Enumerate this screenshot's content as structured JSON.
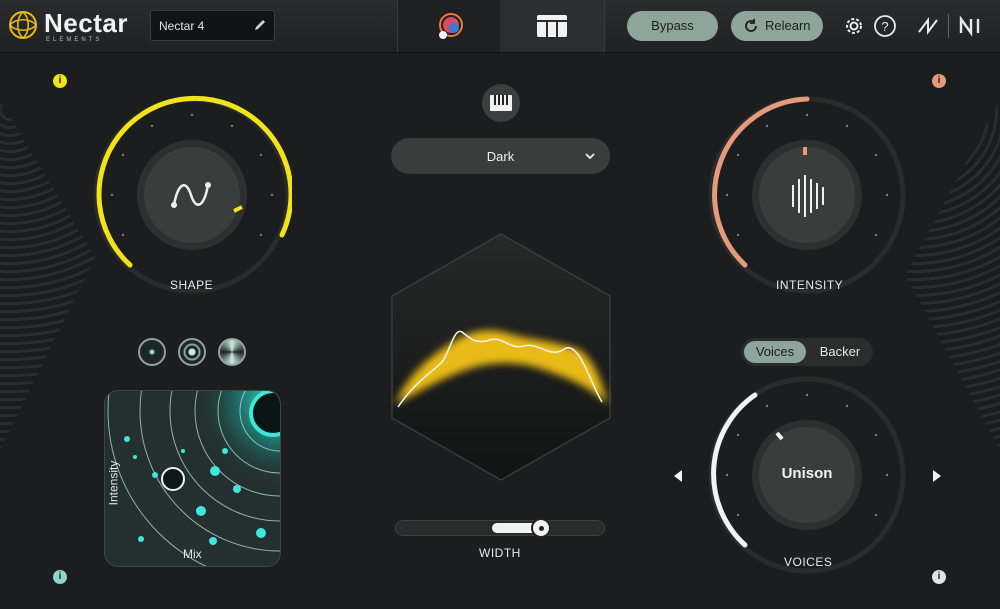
{
  "app": {
    "name": "Nectar",
    "subname": "ELEMENTS"
  },
  "preset": {
    "name": "Nectar 4"
  },
  "header": {
    "bypass_label": "Bypass",
    "relearn_label": "Relearn"
  },
  "style": {
    "selected": "Dark"
  },
  "shape": {
    "label": "SHAPE",
    "level": 0.72
  },
  "intensity": {
    "label": "INTENSITY",
    "level": 0.45
  },
  "voices": {
    "segments": [
      "Voices",
      "Backer"
    ],
    "active": "Voices",
    "mode": "Unison",
    "label": "VOICES"
  },
  "width": {
    "label": "WIDTH",
    "value": 0.7
  },
  "mixpad": {
    "x_label": "Mix",
    "y_label": "Intensity"
  },
  "colors": {
    "shape_accent": "#f2e21a",
    "intensity_accent": "#e59a7c",
    "voices_accent": "#f3f3f3",
    "pill": "#8fa49a",
    "glow": "#f5c419",
    "pad_glow": "#3ee8d8"
  },
  "icons": {
    "tab_visual": "nectar-orb-icon",
    "tab_modules": "modules-icon",
    "settings": "gear-icon",
    "help": "help-icon",
    "izotope": "izotope-logo-icon",
    "ni": "ni-logo-icon",
    "keys": "piano-keys-icon",
    "edit": "pencil-icon",
    "relearn": "refresh-icon"
  }
}
